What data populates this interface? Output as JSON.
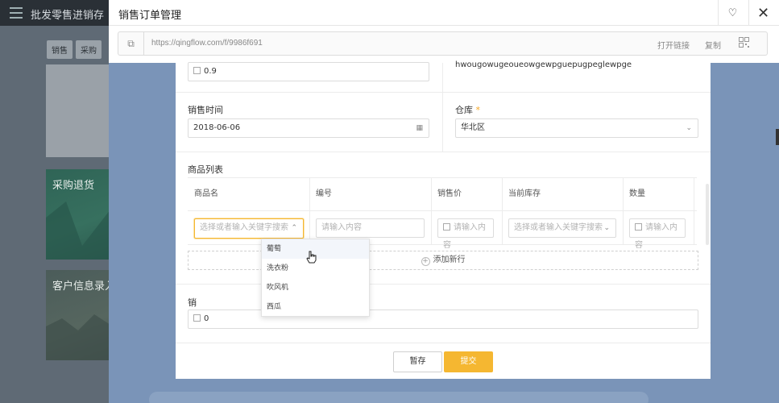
{
  "background": {
    "app_title": "批发零售进销存",
    "tabs": [
      "销售",
      "采购"
    ],
    "cards": [
      "采购退货",
      "客户信息录入"
    ]
  },
  "modal": {
    "title": "销售订单管理",
    "heart_icon": "♡",
    "close_icon": "✕"
  },
  "linkbar": {
    "url": "https://qingflow.com/f/9986f691",
    "open_label": "打开链接",
    "copy_label": "复制"
  },
  "form": {
    "top_value": "0.9",
    "top_text": "hwougowugeoueowgewpguepugpeglewpge",
    "sale_time_label": "销售时间",
    "sale_time_value": "2018-06-06",
    "warehouse_label": "仓库",
    "warehouse_value": "华北区",
    "product_list_label": "商品列表",
    "columns": [
      "商品名",
      "编号",
      "销售价",
      "当前库存",
      "数量"
    ],
    "product_placeholder": "选择或者输入关键字搜索",
    "code_placeholder": "请输入内容",
    "price_placeholder": "请输入内容",
    "stock_placeholder": "选择或者输入关键字搜索",
    "qty_placeholder": "请输入内容",
    "add_row_label": "添加新行",
    "total_label": "销",
    "total_value": "0"
  },
  "dropdown": {
    "options": [
      "葡萄",
      "洗衣粉",
      "吹风机",
      "西瓜"
    ]
  },
  "footer": {
    "save_label": "暂存",
    "submit_label": "提交"
  },
  "colors": {
    "accent": "#f5b731",
    "required": "#f5a623"
  }
}
